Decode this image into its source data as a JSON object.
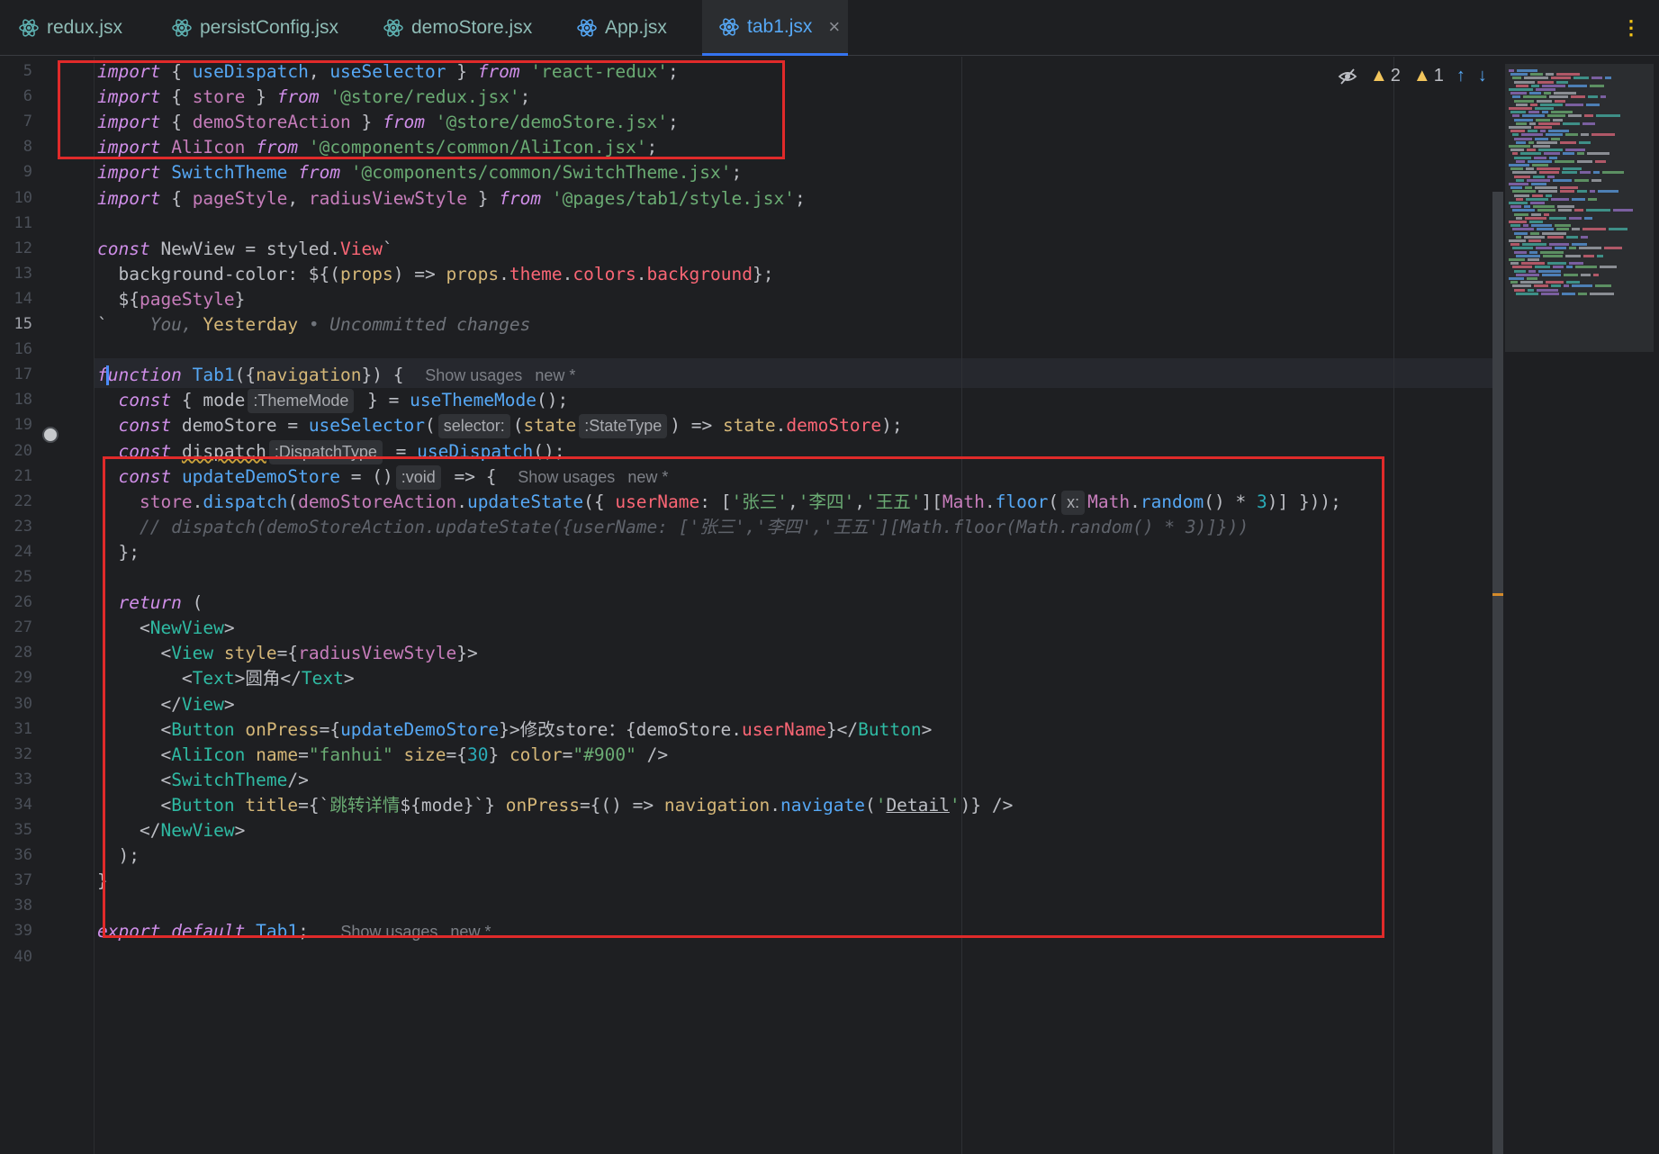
{
  "tabs": [
    {
      "label": "redux.jsx"
    },
    {
      "label": "persistConfig.jsx"
    },
    {
      "label": "demoStore.jsx"
    },
    {
      "label": "App.jsx"
    },
    {
      "label": "tab1.jsx",
      "close": "×"
    }
  ],
  "menu_icon": "⋮",
  "status": {
    "warnings_a": "2",
    "warnings_b": "1",
    "up_arrow": "↑",
    "down_arrow": "↓"
  },
  "line_numbers": [
    "5",
    "6",
    "7",
    "8",
    "9",
    "10",
    "11",
    "12",
    "13",
    "14",
    "15",
    "16",
    "17",
    "18",
    "19",
    "20",
    "21",
    "22",
    "23",
    "24",
    "25",
    "26",
    "27",
    "28",
    "29",
    "30",
    "31",
    "32",
    "33",
    "34",
    "35",
    "36",
    "37",
    "38",
    "39",
    "40"
  ],
  "current_line": "15",
  "code_lines": [
    [
      [
        "kw",
        "import"
      ],
      [
        "plain",
        " { "
      ],
      [
        "fn",
        "useDispatch"
      ],
      [
        "plain",
        ", "
      ],
      [
        "fn",
        "useSelector"
      ],
      [
        "plain",
        " } "
      ],
      [
        "kw",
        "from"
      ],
      [
        "plain",
        " "
      ],
      [
        "str",
        "'react-redux'"
      ],
      [
        "plain",
        ";"
      ]
    ],
    [
      [
        "kw",
        "import"
      ],
      [
        "plain",
        " { "
      ],
      [
        "var",
        "store"
      ],
      [
        "plain",
        " } "
      ],
      [
        "kw",
        "from"
      ],
      [
        "plain",
        " "
      ],
      [
        "str",
        "'@store/redux.jsx'"
      ],
      [
        "plain",
        ";"
      ]
    ],
    [
      [
        "kw",
        "import"
      ],
      [
        "plain",
        " { "
      ],
      [
        "var",
        "demoStoreAction"
      ],
      [
        "plain",
        " } "
      ],
      [
        "kw",
        "from"
      ],
      [
        "plain",
        " "
      ],
      [
        "str",
        "'@store/demoStore.jsx'"
      ],
      [
        "plain",
        ";"
      ]
    ],
    [
      [
        "kw",
        "import"
      ],
      [
        "plain",
        " "
      ],
      [
        "var",
        "AliIcon"
      ],
      [
        "plain",
        " "
      ],
      [
        "kw",
        "from"
      ],
      [
        "plain",
        " "
      ],
      [
        "str",
        "'@components/common/AliIcon.jsx'"
      ],
      [
        "plain",
        ";"
      ]
    ],
    [
      [
        "kw",
        "import"
      ],
      [
        "plain",
        " "
      ],
      [
        "fn",
        "SwitchTheme"
      ],
      [
        "plain",
        " "
      ],
      [
        "kw",
        "from"
      ],
      [
        "plain",
        " "
      ],
      [
        "str",
        "'@components/common/SwitchTheme.jsx'"
      ],
      [
        "plain",
        ";"
      ]
    ],
    [
      [
        "kw",
        "import"
      ],
      [
        "plain",
        " { "
      ],
      [
        "var",
        "pageStyle"
      ],
      [
        "plain",
        ", "
      ],
      [
        "var",
        "radiusViewStyle"
      ],
      [
        "plain",
        " } "
      ],
      [
        "kw",
        "from"
      ],
      [
        "plain",
        " "
      ],
      [
        "str",
        "'@pages/tab1/style.jsx'"
      ],
      [
        "plain",
        ";"
      ]
    ],
    [],
    [
      [
        "kw",
        "const"
      ],
      [
        "plain",
        " NewView = styled."
      ],
      [
        "prop",
        "View"
      ],
      [
        "plain",
        "`"
      ]
    ],
    [
      [
        "plain",
        "  background-color: ${("
      ],
      [
        "ann",
        "props"
      ],
      [
        "plain",
        ") => "
      ],
      [
        "ann",
        "props"
      ],
      [
        "plain",
        "."
      ],
      [
        "prop",
        "theme"
      ],
      [
        "plain",
        "."
      ],
      [
        "prop",
        "colors"
      ],
      [
        "plain",
        "."
      ],
      [
        "prop",
        "background"
      ],
      [
        "plain",
        "};"
      ]
    ],
    [
      [
        "plain",
        "  ${"
      ],
      [
        "var",
        "pageStyle"
      ],
      [
        "plain",
        "}"
      ]
    ],
    [
      [
        "plain",
        "`    "
      ],
      [
        "blame",
        "You, "
      ],
      [
        "ann",
        "Yesterday"
      ],
      [
        "blame",
        " • Uncommitted changes"
      ]
    ],
    [],
    [
      [
        "kw",
        "function"
      ],
      [
        "plain",
        " "
      ],
      [
        "fn",
        "Tab1"
      ],
      [
        "plain",
        "({"
      ],
      [
        "ann",
        "navigation"
      ],
      [
        "plain",
        "}) { "
      ],
      [
        "usage",
        "Show usages"
      ],
      [
        "usage",
        "new *"
      ]
    ],
    [
      [
        "plain",
        "  "
      ],
      [
        "kw",
        "const"
      ],
      [
        "plain",
        " { mode"
      ],
      [
        "hint",
        ":ThemeMode"
      ],
      [
        "plain",
        " } = "
      ],
      [
        "fn",
        "useThemeMode"
      ],
      [
        "plain",
        "();"
      ]
    ],
    [
      [
        "plain",
        "  "
      ],
      [
        "kw",
        "const"
      ],
      [
        "plain",
        " demoStore = "
      ],
      [
        "fn",
        "useSelector"
      ],
      [
        "plain",
        "("
      ],
      [
        "hint",
        "selector:"
      ],
      [
        "plain",
        "("
      ],
      [
        "ann",
        "state"
      ],
      [
        "hint",
        ":StateType"
      ],
      [
        "plain",
        ") => "
      ],
      [
        "ann",
        "state"
      ],
      [
        "plain",
        "."
      ],
      [
        "prop",
        "demoStore"
      ],
      [
        "plain",
        ");"
      ]
    ],
    [
      [
        "plain",
        "  "
      ],
      [
        "kw",
        "const"
      ],
      [
        "plain",
        " "
      ],
      [
        "squig",
        "dispatch"
      ],
      [
        "hint",
        ":DispatchType"
      ],
      [
        "plain",
        " = "
      ],
      [
        "fn",
        "useDispatch"
      ],
      [
        "plain",
        "();"
      ]
    ],
    [
      [
        "plain",
        "  "
      ],
      [
        "kw",
        "const"
      ],
      [
        "plain",
        " "
      ],
      [
        "fn",
        "updateDemoStore"
      ],
      [
        "plain",
        " = ()"
      ],
      [
        "hint",
        ":void"
      ],
      [
        "plain",
        " => { "
      ],
      [
        "usage",
        "Show usages"
      ],
      [
        "usage",
        "new *"
      ]
    ],
    [
      [
        "plain",
        "    "
      ],
      [
        "var",
        "store"
      ],
      [
        "plain",
        "."
      ],
      [
        "fn",
        "dispatch"
      ],
      [
        "plain",
        "("
      ],
      [
        "var",
        "demoStoreAction"
      ],
      [
        "plain",
        "."
      ],
      [
        "fn",
        "updateState"
      ],
      [
        "plain",
        "({ "
      ],
      [
        "prop",
        "userName"
      ],
      [
        "plain",
        ": ["
      ],
      [
        "str",
        "'张三'"
      ],
      [
        "plain",
        ","
      ],
      [
        "str",
        "'李四'"
      ],
      [
        "plain",
        ","
      ],
      [
        "str",
        "'王五'"
      ],
      [
        "plain",
        "]["
      ],
      [
        "var",
        "Math"
      ],
      [
        "plain",
        "."
      ],
      [
        "fn",
        "floor"
      ],
      [
        "plain",
        "("
      ],
      [
        "hint",
        "x:"
      ],
      [
        "var",
        "Math"
      ],
      [
        "plain",
        "."
      ],
      [
        "fn",
        "random"
      ],
      [
        "plain",
        "() * "
      ],
      [
        "num",
        "3"
      ],
      [
        "plain",
        ")] }));"
      ]
    ],
    [
      [
        "cmt",
        "    // dispatch(demoStoreAction.updateState({userName: ['张三','李四','王五'][Math.floor(Math.random() * 3)]}))"
      ]
    ],
    [
      [
        "plain",
        "  };"
      ]
    ],
    [],
    [
      [
        "plain",
        "  "
      ],
      [
        "kw",
        "return"
      ],
      [
        "plain",
        " ("
      ]
    ],
    [
      [
        "plain",
        "    <"
      ],
      [
        "tag",
        "NewView"
      ],
      [
        "plain",
        ">"
      ]
    ],
    [
      [
        "plain",
        "      <"
      ],
      [
        "tag",
        "View"
      ],
      [
        "plain",
        " "
      ],
      [
        "ann",
        "style"
      ],
      [
        "plain",
        "={"
      ],
      [
        "var",
        "radiusViewStyle"
      ],
      [
        "plain",
        "}>"
      ]
    ],
    [
      [
        "plain",
        "        <"
      ],
      [
        "tag",
        "Text"
      ],
      [
        "plain",
        ">圆角</"
      ],
      [
        "tag",
        "Text"
      ],
      [
        "plain",
        ">"
      ]
    ],
    [
      [
        "plain",
        "      </"
      ],
      [
        "tag",
        "View"
      ],
      [
        "plain",
        ">"
      ]
    ],
    [
      [
        "plain",
        "      <"
      ],
      [
        "tag",
        "Button"
      ],
      [
        "plain",
        " "
      ],
      [
        "ann",
        "onPress"
      ],
      [
        "plain",
        "={"
      ],
      [
        "fn",
        "updateDemoStore"
      ],
      [
        "plain",
        "}>修改store：{demoStore."
      ],
      [
        "prop",
        "userName"
      ],
      [
        "plain",
        "}</"
      ],
      [
        "tag",
        "Button"
      ],
      [
        "plain",
        ">"
      ]
    ],
    [
      [
        "plain",
        "      <"
      ],
      [
        "tag",
        "AliIcon"
      ],
      [
        "plain",
        " "
      ],
      [
        "ann",
        "name"
      ],
      [
        "plain",
        "="
      ],
      [
        "str",
        "\"fanhui\""
      ],
      [
        "plain",
        " "
      ],
      [
        "ann",
        "size"
      ],
      [
        "plain",
        "={"
      ],
      [
        "num",
        "30"
      ],
      [
        "plain",
        "} "
      ],
      [
        "ann",
        "color"
      ],
      [
        "plain",
        "="
      ],
      [
        "str",
        "\"#900\""
      ],
      [
        "plain",
        " />"
      ]
    ],
    [
      [
        "plain",
        "      <"
      ],
      [
        "tag",
        "SwitchTheme"
      ],
      [
        "plain",
        "/>"
      ]
    ],
    [
      [
        "plain",
        "      <"
      ],
      [
        "tag",
        "Button"
      ],
      [
        "plain",
        " "
      ],
      [
        "ann",
        "title"
      ],
      [
        "plain",
        "={`"
      ],
      [
        "str",
        "跳转详情"
      ],
      [
        "plain",
        "${mode}`} "
      ],
      [
        "ann",
        "onPress"
      ],
      [
        "plain",
        "={() => "
      ],
      [
        "ann",
        "navigation"
      ],
      [
        "plain",
        "."
      ],
      [
        "fn",
        "navigate"
      ],
      [
        "plain",
        "("
      ],
      [
        "str",
        "'"
      ],
      [
        "ul",
        "Detail"
      ],
      [
        "str",
        "'"
      ],
      [
        "plain",
        ")} />"
      ]
    ],
    [
      [
        "plain",
        "    </"
      ],
      [
        "tag",
        "NewView"
      ],
      [
        "plain",
        ">"
      ]
    ],
    [
      [
        "plain",
        "  );"
      ]
    ],
    [
      [
        "plain",
        "}"
      ]
    ],
    [],
    [
      [
        "kw",
        "export"
      ],
      [
        "plain",
        " "
      ],
      [
        "kw",
        "default"
      ],
      [
        "plain",
        " "
      ],
      [
        "fn",
        "Tab1"
      ],
      [
        "plain",
        ";  "
      ],
      [
        "usage",
        "Show usages"
      ],
      [
        "usage",
        "new *"
      ]
    ],
    []
  ],
  "colors": {
    "background": "#1e1f22",
    "keyword": "#cf8ee8",
    "function": "#56a8f5",
    "string": "#6aab73",
    "highlight_box": "#e02a2a",
    "tab_active": "#3574f0"
  }
}
